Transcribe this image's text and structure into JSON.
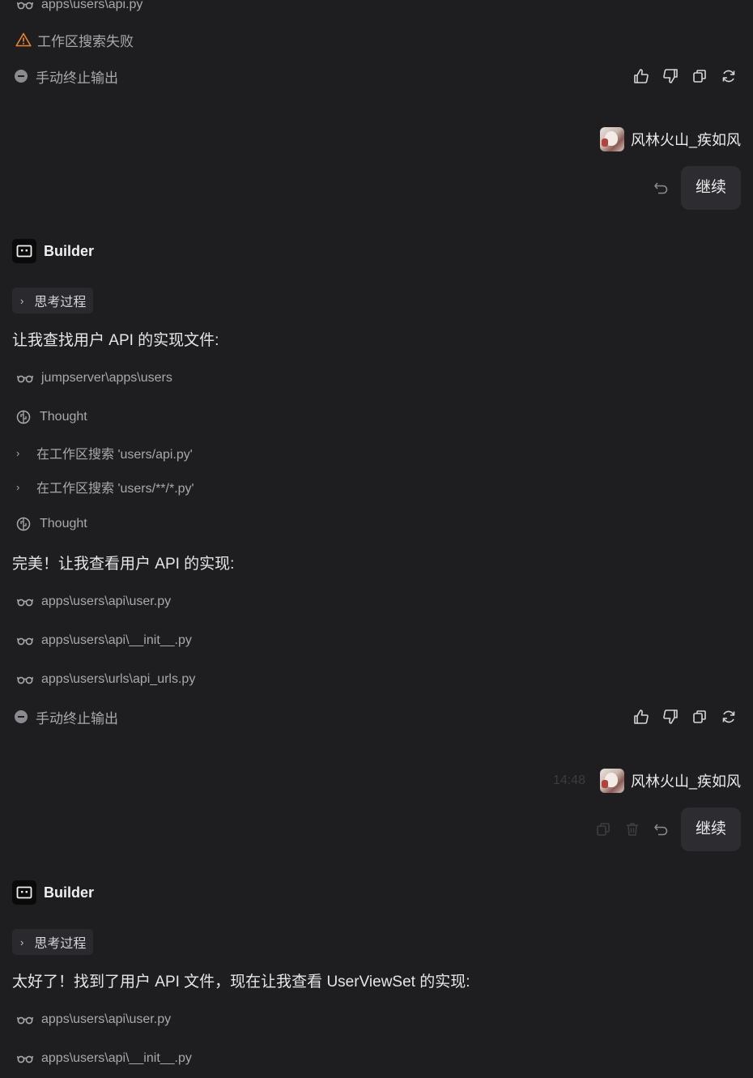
{
  "messages": {
    "top": {
      "file_partial": "apps\\users\\api.py",
      "warning": "工作区搜索失败",
      "stopped": "手动终止输出"
    },
    "user1": {
      "name": "风林火山_疾如风",
      "message": "继续"
    },
    "builder1": {
      "name": "Builder",
      "thinking": "思考过程",
      "intro": "让我查找用户 API 的实现文件:",
      "folder": "jumpserver\\apps\\users",
      "thought1": "Thought",
      "search1": "在工作区搜索 'users/api.py'",
      "search2": "在工作区搜索 'users/**/*.py'",
      "thought2": "Thought",
      "text2": "完美！让我查看用户 API 的实现:",
      "file1": "apps\\users\\api\\user.py",
      "file2": "apps\\users\\api\\__init__.py",
      "file3": "apps\\users\\urls\\api_urls.py",
      "stopped": "手动终止输出"
    },
    "user2": {
      "time": "14:48",
      "name": "风林火山_疾如风",
      "message": "继续"
    },
    "builder2": {
      "name": "Builder",
      "thinking": "思考过程",
      "intro": "太好了！找到了用户 API 文件，现在让我查看 UserViewSet 的实现:",
      "file1": "apps\\users\\api\\user.py",
      "file2": "apps\\users\\api\\__init__.py"
    }
  },
  "colors": {
    "background": "#1e1e20",
    "warning": "#e8862c",
    "bubble": "#2d2d31",
    "muted_text": "#a9a9ad"
  },
  "icons": {
    "view_file": "glasses-icon",
    "warning": "warning-triangle-icon",
    "stopped": "stop-circle-icon",
    "thought": "brain-icon",
    "expand": "chevron-right-icon",
    "like": "thumbs-up-icon",
    "dislike": "thumbs-down-icon",
    "copy": "copy-icon",
    "regenerate": "refresh-icon",
    "undo": "undo-icon",
    "delete": "trash-icon",
    "builder_logo": "builder-logo-icon"
  }
}
